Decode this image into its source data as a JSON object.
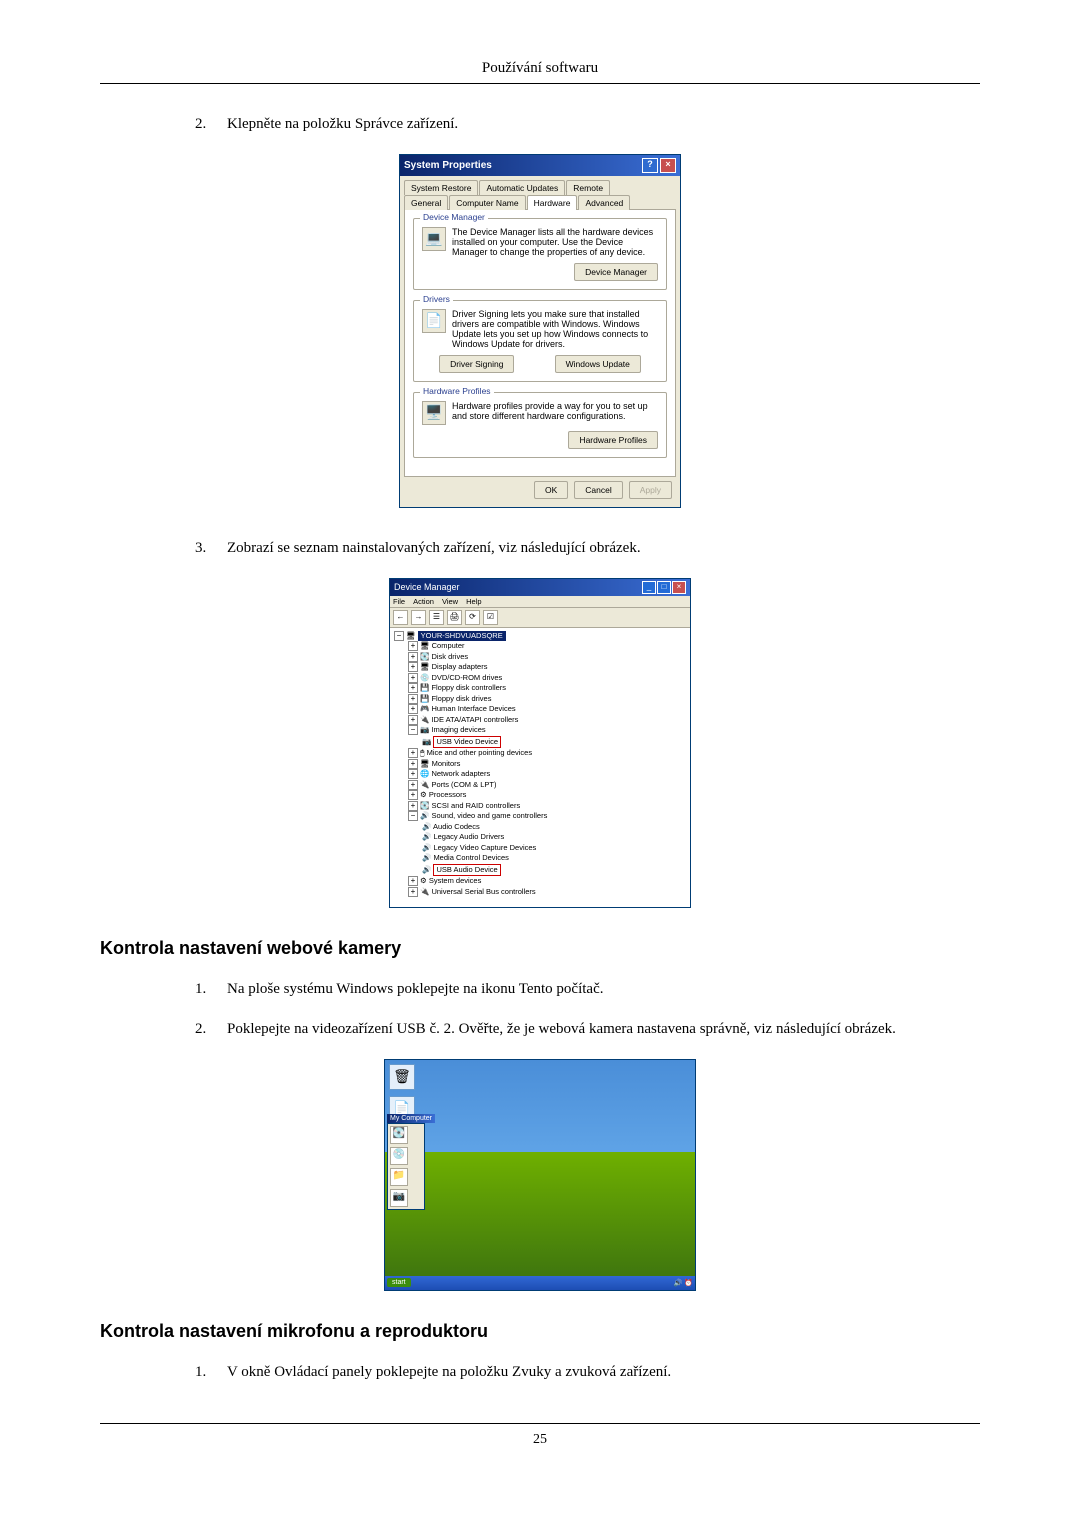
{
  "page_header": "Používání softwaru",
  "page_number": "25",
  "step2": {
    "num": "2.",
    "text": "Klepněte na položku Správce zařízení."
  },
  "step3": {
    "num": "3.",
    "text": "Zobrazí se seznam nainstalovaných zařízení, viz následující obrázek."
  },
  "section_webcam": "Kontrola nastavení webové kamery",
  "webcam_step1": {
    "num": "1.",
    "text": "Na ploše systému Windows poklepejte na ikonu Tento počítač."
  },
  "webcam_step2": {
    "num": "2.",
    "text": "Poklepejte na videozařízení USB č. 2. Ověřte, že je webová kamera nastavena správně, viz následující obrázek."
  },
  "section_mic": "Kontrola nastavení mikrofonu a reproduktoru",
  "mic_step1": {
    "num": "1.",
    "text": "V okně Ovládací panely poklepejte na položku Zvuky a zvuková zařízení."
  },
  "sysprop": {
    "title": "System Properties",
    "tabs_row1": [
      "System Restore",
      "Automatic Updates",
      "Remote"
    ],
    "tabs_row2": [
      "General",
      "Computer Name",
      "Hardware",
      "Advanced"
    ],
    "dm": {
      "legend": "Device Manager",
      "desc": "The Device Manager lists all the hardware devices installed on your computer. Use the Device Manager to change the properties of any device.",
      "btn": "Device Manager"
    },
    "drv": {
      "legend": "Drivers",
      "desc": "Driver Signing lets you make sure that installed drivers are compatible with Windows. Windows Update lets you set up how Windows connects to Windows Update for drivers.",
      "btn1": "Driver Signing",
      "btn2": "Windows Update"
    },
    "hp": {
      "legend": "Hardware Profiles",
      "desc": "Hardware profiles provide a way for you to set up and store different hardware configurations.",
      "btn": "Hardware Profiles"
    },
    "ok": "OK",
    "cancel": "Cancel",
    "apply": "Apply"
  },
  "devmgr": {
    "title": "Device Manager",
    "menus": [
      "File",
      "Action",
      "View",
      "Help"
    ],
    "root": "YOUR-SHDVUADSQRE",
    "nodes": [
      "Computer",
      "Disk drives",
      "Display adapters",
      "DVD/CD-ROM drives",
      "Floppy disk controllers",
      "Floppy disk drives",
      "Human Interface Devices",
      "IDE ATA/ATAPI controllers",
      "Imaging devices"
    ],
    "usb_video": "USB Video Device",
    "nodes2": [
      "Mice and other pointing devices",
      "Monitors",
      "Network adapters",
      "Ports (COM & LPT)",
      "Processors",
      "SCSI and RAID controllers",
      "Sound, video and game controllers"
    ],
    "svg_children": [
      "Audio Codecs",
      "Legacy Audio Drivers",
      "Legacy Video Capture Devices",
      "Media Control Devices"
    ],
    "usb_audio": "USB Audio Device",
    "nodes3": [
      "System devices",
      "Universal Serial Bus controllers"
    ]
  },
  "desktop": {
    "mycomputer_title": "My Computer",
    "start": "start"
  }
}
